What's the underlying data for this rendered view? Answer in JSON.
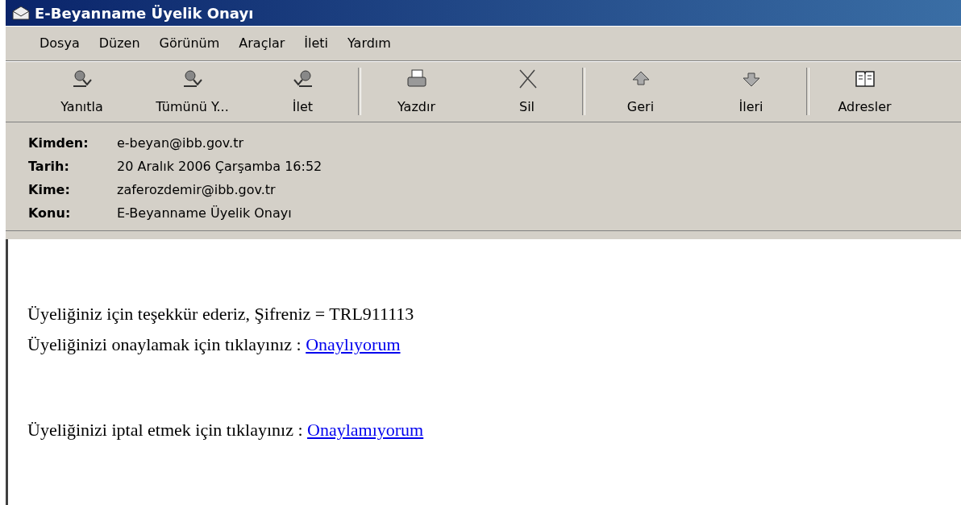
{
  "window": {
    "title": "E-Beyanname Üyelik Onayı"
  },
  "menu": [
    "Dosya",
    "Düzen",
    "Görünüm",
    "Araçlar",
    "İleti",
    "Yardım"
  ],
  "toolbar": [
    [
      {
        "kind": "reply",
        "label": "Yanıtla"
      },
      {
        "kind": "reply_all",
        "label": "Tümünü Y..."
      },
      {
        "kind": "forward",
        "label": "İlet"
      }
    ],
    [
      {
        "kind": "print",
        "label": "Yazdır"
      },
      {
        "kind": "delete",
        "label": "Sil"
      }
    ],
    [
      {
        "kind": "up",
        "label": "Geri"
      },
      {
        "kind": "down",
        "label": "İleri"
      }
    ],
    [
      {
        "kind": "book",
        "label": "Adresler"
      }
    ]
  ],
  "header": [
    {
      "label": "Kimden:",
      "value": "e-beyan@ibb.gov.tr"
    },
    {
      "label": "Tarih:",
      "value": "20 Aralık 2006 Çarşamba 16:52"
    },
    {
      "label": "Kime:",
      "value": "zaferozdemir@ibb.gov.tr"
    },
    {
      "label": "Konu:",
      "value": "E-Beyanname Üyelik Onayı"
    }
  ],
  "body": [
    [
      {
        "text": "Üyeliğiniz için teşekkür ederiz, Şifreniz = TRL911113"
      },
      {
        "text": "Üyeliğinizi onaylamak için tıklayınız : ",
        "link": "Onaylıyorum"
      }
    ],
    [
      {
        "text": "Üyeliğinizi iptal etmek için tıklayınız : ",
        "link": "Onaylamıyorum"
      }
    ]
  ]
}
